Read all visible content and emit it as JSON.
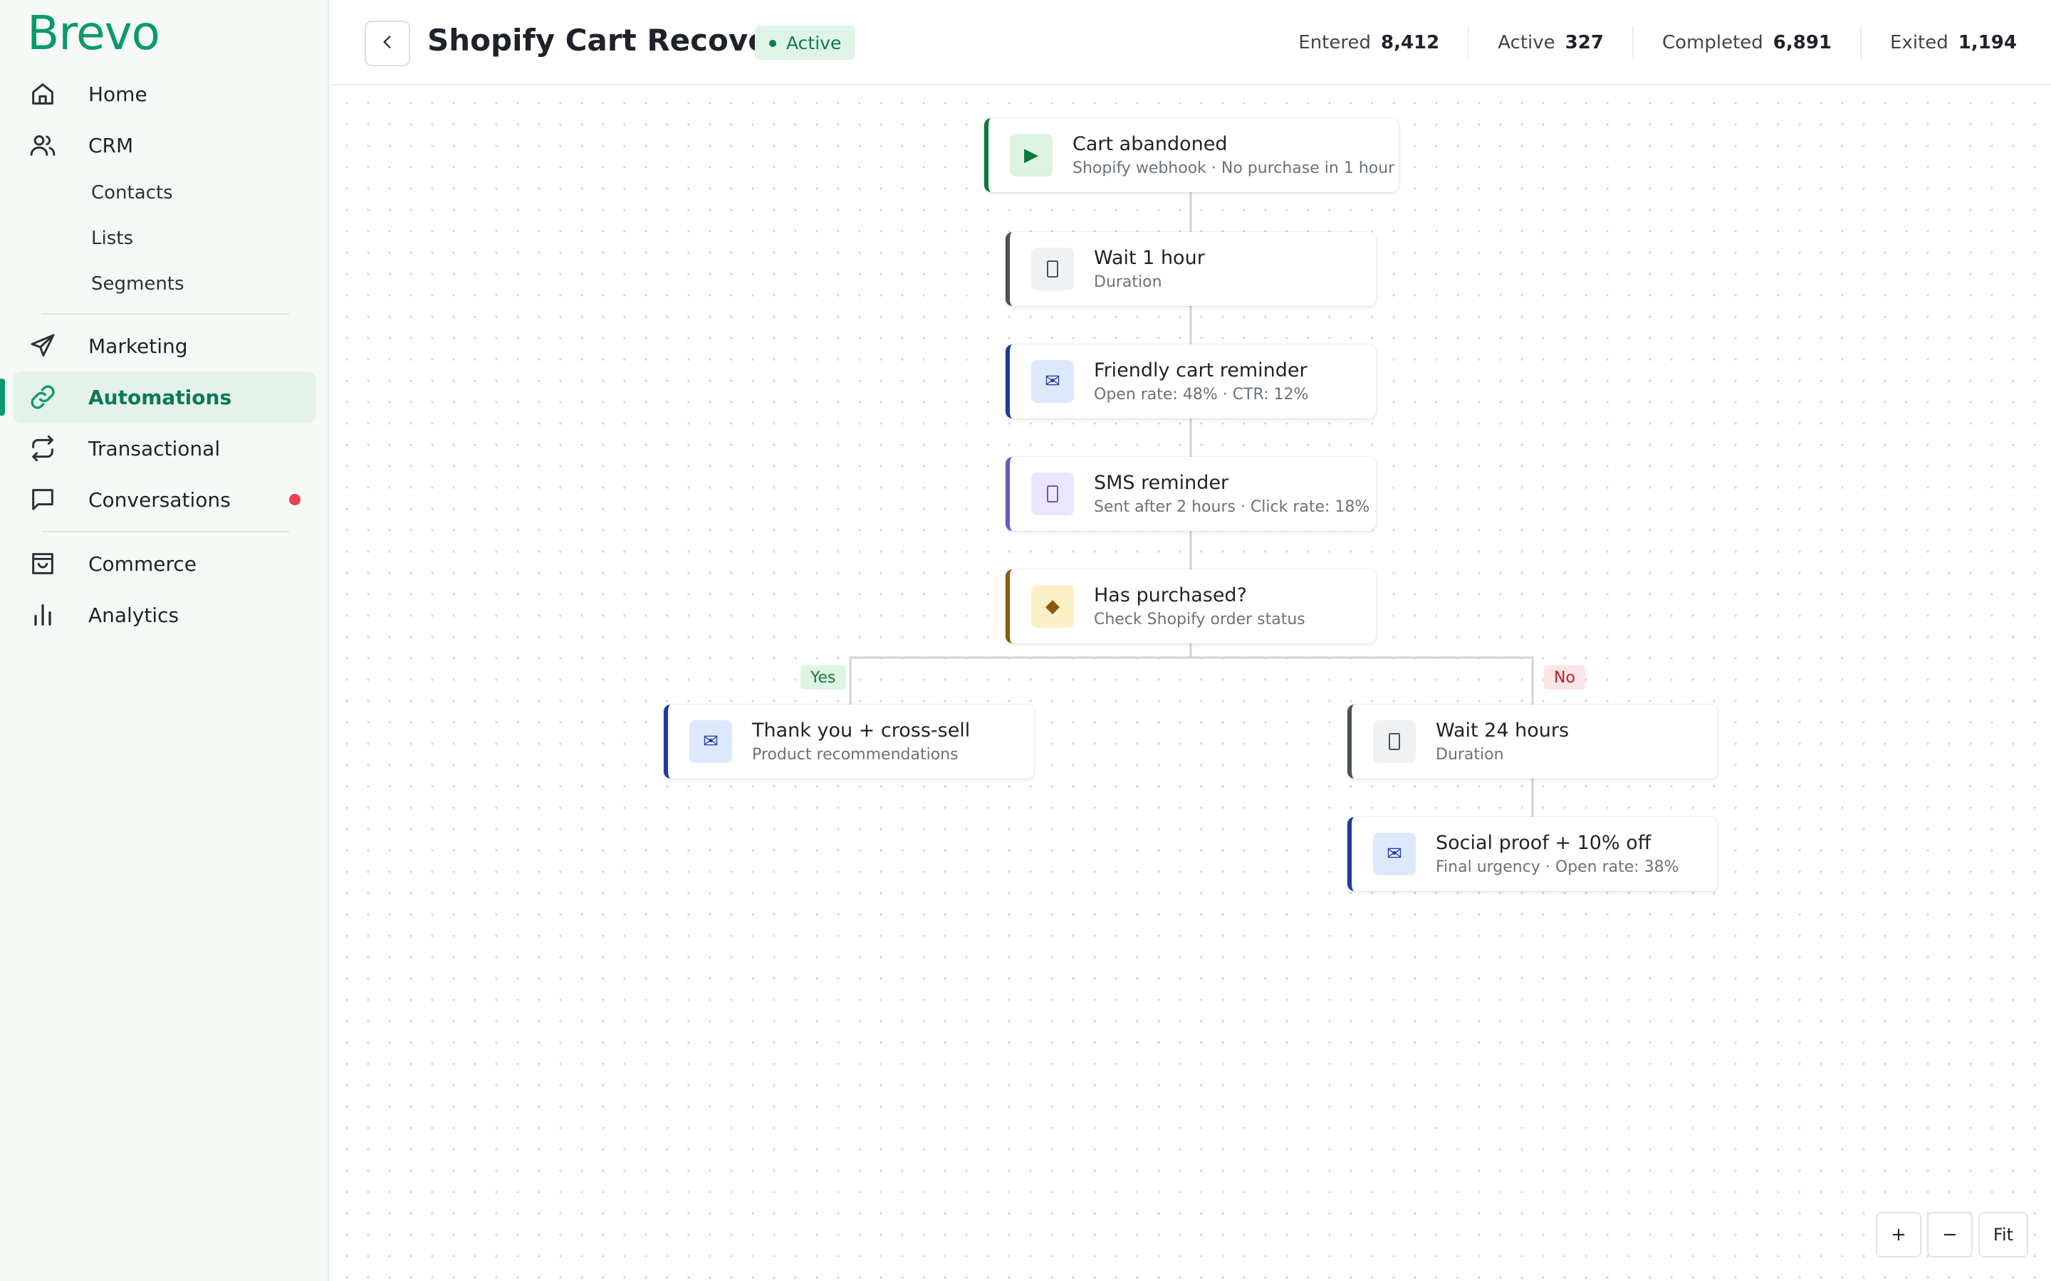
{
  "brand": {
    "logo_text": "Brevo",
    "color": "#0b996e"
  },
  "sidebar": {
    "items": [
      {
        "label": "Home",
        "icon": "home-icon"
      },
      {
        "label": "CRM",
        "icon": "users-icon"
      },
      {
        "label": "Marketing",
        "icon": "send-icon"
      },
      {
        "label": "Automations",
        "icon": "link-icon",
        "active": true
      },
      {
        "label": "Transactional",
        "icon": "repeat-icon"
      },
      {
        "label": "Conversations",
        "icon": "chat-icon",
        "has_notification": true
      },
      {
        "label": "Commerce",
        "icon": "shopping-bag-icon"
      },
      {
        "label": "Analytics",
        "icon": "bar-chart-icon"
      }
    ],
    "crm_subitems": [
      "Contacts",
      "Lists",
      "Segments"
    ]
  },
  "header": {
    "title": "Shopify Cart Recovery",
    "status": "Active",
    "stats": [
      {
        "label": "Entered",
        "value": "8,412"
      },
      {
        "label": "Active",
        "value": "327"
      },
      {
        "label": "Completed",
        "value": "6,891"
      },
      {
        "label": "Exited",
        "value": "1,194"
      }
    ]
  },
  "workflow": {
    "nodes": [
      {
        "type": "trigger",
        "icon": "play-icon",
        "title": "Cart abandoned",
        "subtitle": "Shopify webhook · No purchase in 1 hour"
      },
      {
        "type": "wait",
        "icon": "hourglass-icon",
        "title": "Wait 1 hour",
        "subtitle": "Duration"
      },
      {
        "type": "email",
        "icon": "envelope-icon",
        "title": "Friendly cart reminder",
        "subtitle": "Open rate: 48% · CTR: 12%"
      },
      {
        "type": "sms",
        "icon": "phone-icon",
        "title": "SMS reminder",
        "subtitle": "Sent after 2 hours · Click rate: 18%"
      },
      {
        "type": "condition",
        "icon": "diamond-icon",
        "title": "Has purchased?",
        "subtitle": "Check Shopify order status"
      },
      {
        "type": "email",
        "icon": "envelope-icon",
        "title": "Thank you + cross-sell",
        "subtitle": "Product recommendations"
      },
      {
        "type": "wait",
        "icon": "hourglass-icon",
        "title": "Wait 24 hours",
        "subtitle": "Duration"
      },
      {
        "type": "email",
        "icon": "envelope-icon",
        "title": "Social proof + 10% off",
        "subtitle": "Final urgency · Open rate: 38%"
      }
    ],
    "branches": {
      "yes": "Yes",
      "no": "No"
    }
  },
  "zoom_controls": {
    "zoom_in": "+",
    "zoom_out": "−",
    "fit": "Fit"
  }
}
